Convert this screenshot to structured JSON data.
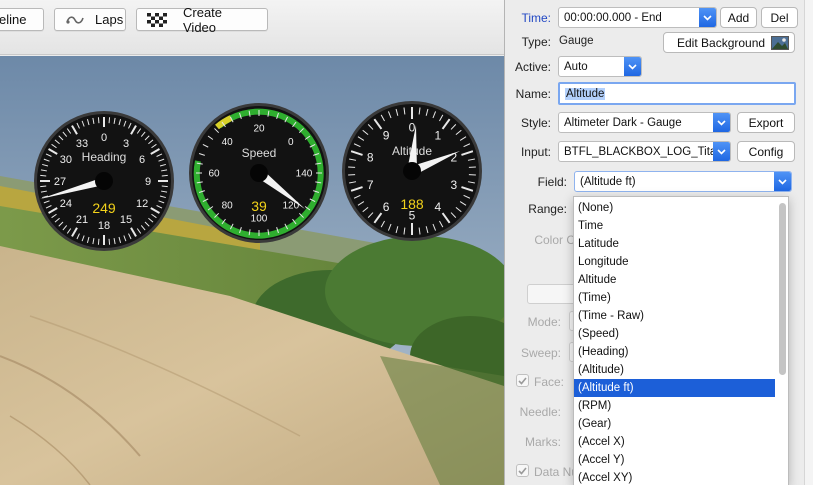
{
  "toolbar": {
    "timeline_label": "eline",
    "laps_label": "Laps",
    "create_video_label": "Create Video"
  },
  "gauges": {
    "heading": {
      "title": "Heading",
      "value": "249",
      "ticks": [
        "0",
        "3",
        "6",
        "9",
        "12",
        "15",
        "18",
        "21",
        "24",
        "27",
        "30",
        "33"
      ]
    },
    "speed": {
      "title": "Speed",
      "value": "39",
      "ticks": [
        "0",
        "20",
        "40",
        "60",
        "80",
        "100",
        "120",
        "140"
      ]
    },
    "altitude": {
      "title": "Altitude",
      "value": "188",
      "ticks": [
        "0",
        "1",
        "2",
        "3",
        "4",
        "5",
        "6",
        "7",
        "8",
        "9"
      ]
    }
  },
  "panel": {
    "time_label": "Time:",
    "time_value": "00:00:00.000 - End",
    "add_label": "Add",
    "del_label": "Del",
    "type_label": "Type:",
    "type_value": "Gauge",
    "edit_background_label": "Edit Background",
    "active_label": "Active:",
    "active_value": "Auto",
    "name_label": "Name:",
    "name_value": "Altitude",
    "style_label": "Style:",
    "style_value": "Altimeter Dark - Gauge",
    "export_label": "Export",
    "input_label": "Input:",
    "input_value": "BTFL_BLACKBOX_LOG_Titan",
    "config_label": "Config",
    "field_label": "Field:",
    "field_value": "(Altitude ft)",
    "range_label": "Range:",
    "color_label": "Color C",
    "mode_label": "Mode:",
    "sweep_label": "Sweep:",
    "face_label": "Face:",
    "needle_label": "Needle:",
    "marks_label": "Marks:",
    "data_label": "Data Nu"
  },
  "dropdown": {
    "selected_index": 10,
    "items": [
      "(None)",
      "Time",
      "Latitude",
      "Longitude",
      "Altitude",
      "(Time)",
      "(Time - Raw)",
      "(Speed)",
      "(Heading)",
      "(Altitude)",
      "(Altitude ft)",
      "(RPM)",
      "(Gear)",
      "(Accel X)",
      "(Accel Y)",
      "(Accel XY)"
    ]
  },
  "colors": {
    "accent_blue": "#1c5fd8",
    "label_blue": "#2248c4",
    "gauge_face": "#111111",
    "gauge_value": "#f2d21a",
    "speed_arc": "#2fae2f"
  }
}
